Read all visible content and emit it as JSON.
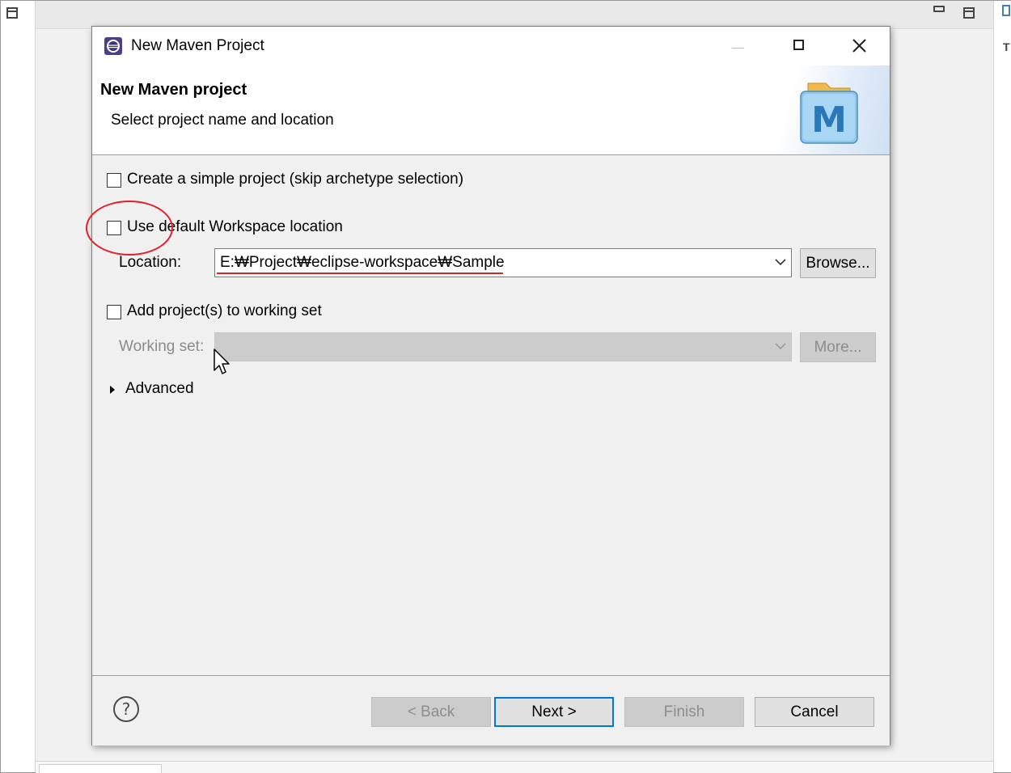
{
  "dialog": {
    "title": "New Maven Project",
    "banner_title": "New Maven project",
    "banner_subtitle": "Select project name and location"
  },
  "options": {
    "simple_project": {
      "label": "Create a simple project (skip archetype selection)",
      "checked": false
    },
    "default_location": {
      "label": "Use default Workspace location",
      "checked": false
    },
    "location_label": "Location:",
    "location_value": "E:₩Project₩eclipse-workspace₩Sample",
    "browse_label": "Browse...",
    "working_set_checkbox": {
      "label": "Add project(s) to working set",
      "checked": false
    },
    "working_set_label": "Working set:",
    "more_label": "More...",
    "advanced_label": "Advanced"
  },
  "footer": {
    "back_label": "< Back",
    "next_label": "Next >",
    "finish_label": "Finish",
    "cancel_label": "Cancel"
  },
  "icons": {
    "app": "eclipse-icon",
    "banner": "maven-folder-icon",
    "help": "help-icon",
    "maven_letter": "M"
  },
  "colors": {
    "annotation_red": "#e0202a",
    "default_button_border": "#0078d7",
    "disabled_fill": "#cccccc"
  }
}
